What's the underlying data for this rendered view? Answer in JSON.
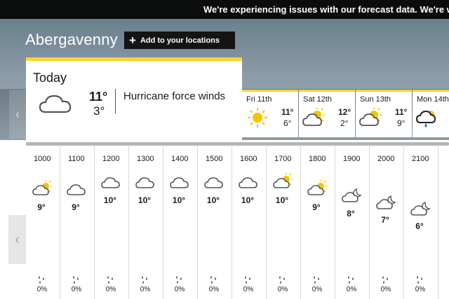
{
  "banner": {
    "text": "We're experiencing issues with our forecast data. We're worki"
  },
  "location": {
    "name": "Abergavenny",
    "add_button": "Add to your locations",
    "add_icon": "+"
  },
  "today": {
    "title": "Today",
    "icon": "cloud-icon",
    "high": "11°",
    "low": "3°",
    "description": "Hurricane force winds"
  },
  "nav": {
    "prev": "‹"
  },
  "days": [
    {
      "name": "Fri 11th",
      "icon": "sun-icon",
      "high": "11°",
      "low": "6°"
    },
    {
      "name": "Sat 12th",
      "icon": "sun-cloud-icon",
      "high": "12°",
      "low": "2°"
    },
    {
      "name": "Sun 13th",
      "icon": "sun-cloud-icon",
      "high": "11°",
      "low": "9°"
    },
    {
      "name": "Mon 14th",
      "icon": "rain-cloud-icon",
      "high": "",
      "low": ""
    }
  ],
  "hours": [
    {
      "time": "1000",
      "icon": "sun-cloud-icon",
      "temp": "9°",
      "rain": "0%"
    },
    {
      "time": "1100",
      "icon": "cloud-icon",
      "temp": "9°",
      "rain": "0%"
    },
    {
      "time": "1200",
      "icon": "cloud-icon",
      "temp": "10°",
      "rain": "0%"
    },
    {
      "time": "1300",
      "icon": "cloud-icon",
      "temp": "10°",
      "rain": "0%"
    },
    {
      "time": "1400",
      "icon": "cloud-icon",
      "temp": "10°",
      "rain": "0%"
    },
    {
      "time": "1500",
      "icon": "cloud-icon",
      "temp": "10°",
      "rain": "0%"
    },
    {
      "time": "1600",
      "icon": "cloud-icon",
      "temp": "10°",
      "rain": "0%"
    },
    {
      "time": "1700",
      "icon": "sun-cloud-icon",
      "temp": "10°",
      "rain": "0%"
    },
    {
      "time": "1800",
      "icon": "sun-cloud-icon",
      "temp": "9°",
      "rain": "0%"
    },
    {
      "time": "1900",
      "icon": "moon-cloud-icon",
      "temp": "8°",
      "rain": "0%"
    },
    {
      "time": "2000",
      "icon": "moon-cloud-icon",
      "temp": "7°",
      "rain": "0%"
    },
    {
      "time": "2100",
      "icon": "moon-cloud-icon",
      "temp": "6°",
      "rain": "0%"
    }
  ],
  "colors": {
    "accent": "#ffd32b",
    "banner_bg": "#0b0c0c",
    "sun": "#f5c400",
    "rain": "#1a6fb5"
  }
}
